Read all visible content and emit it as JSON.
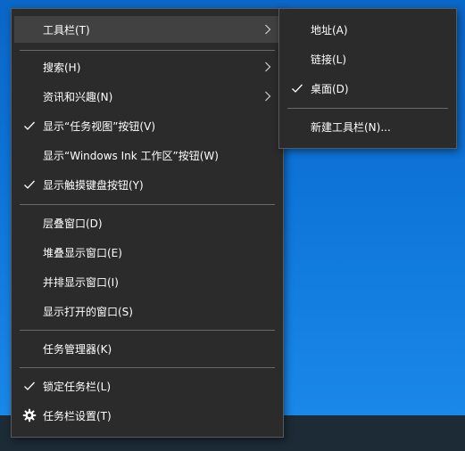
{
  "main_menu": {
    "toolbars": "工具栏(T)",
    "search": "搜索(H)",
    "news_interests": "资讯和兴趣(N)",
    "show_task_view": "显示“任务视图”按钮(V)",
    "show_ink_workspace": "显示“Windows Ink 工作区”按钮(W)",
    "show_touch_keyboard": "显示触摸键盘按钮(Y)",
    "cascade_windows": "层叠窗口(D)",
    "stack_windows": "堆叠显示窗口(E)",
    "side_by_side": "并排显示窗口(I)",
    "show_open_windows": "显示打开的窗口(S)",
    "task_manager": "任务管理器(K)",
    "lock_taskbar": "锁定任务栏(L)",
    "taskbar_settings": "任务栏设置(T)"
  },
  "toolbar_submenu": {
    "address": "地址(A)",
    "links": "链接(L)",
    "desktop": "桌面(D)",
    "new_toolbar": "新建工具栏(N)..."
  },
  "checked": {
    "show_task_view": true,
    "show_touch_keyboard": true,
    "lock_taskbar": true,
    "desktop": true
  },
  "icons": [
    "check-icon",
    "chevron-right-icon",
    "gear-icon"
  ],
  "colors": {
    "menu_bg": "#2b2b2b",
    "hover_bg": "#414141",
    "desktop": "#0e74d8",
    "taskbar": "#1c2b36"
  }
}
